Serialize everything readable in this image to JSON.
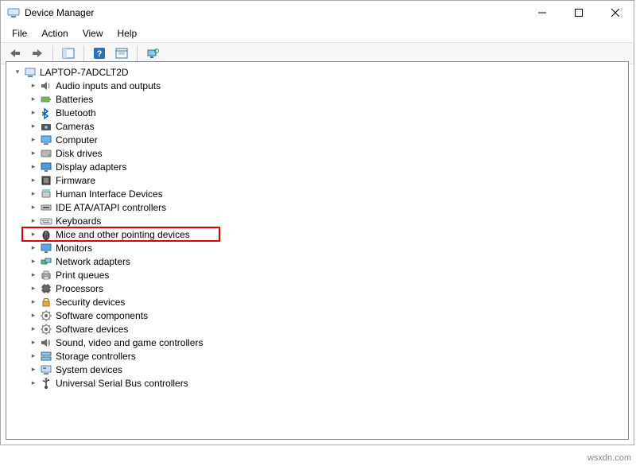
{
  "window": {
    "title": "Device Manager"
  },
  "menu": {
    "file": "File",
    "action": "Action",
    "view": "View",
    "help": "Help"
  },
  "tree": {
    "root": "LAPTOP-7ADCLT2D",
    "items": [
      {
        "label": "Audio inputs and outputs",
        "icon": "audio"
      },
      {
        "label": "Batteries",
        "icon": "battery"
      },
      {
        "label": "Bluetooth",
        "icon": "bluetooth"
      },
      {
        "label": "Cameras",
        "icon": "camera"
      },
      {
        "label": "Computer",
        "icon": "computer"
      },
      {
        "label": "Disk drives",
        "icon": "disk"
      },
      {
        "label": "Display adapters",
        "icon": "display"
      },
      {
        "label": "Firmware",
        "icon": "firmware"
      },
      {
        "label": "Human Interface Devices",
        "icon": "hid"
      },
      {
        "label": "IDE ATA/ATAPI controllers",
        "icon": "ide"
      },
      {
        "label": "Keyboards",
        "icon": "keyboard"
      },
      {
        "label": "Mice and other pointing devices",
        "icon": "mouse",
        "highlighted": true
      },
      {
        "label": "Monitors",
        "icon": "monitor"
      },
      {
        "label": "Network adapters",
        "icon": "network"
      },
      {
        "label": "Print queues",
        "icon": "printer"
      },
      {
        "label": "Processors",
        "icon": "cpu"
      },
      {
        "label": "Security devices",
        "icon": "security"
      },
      {
        "label": "Software components",
        "icon": "software"
      },
      {
        "label": "Software devices",
        "icon": "software"
      },
      {
        "label": "Sound, video and game controllers",
        "icon": "sound"
      },
      {
        "label": "Storage controllers",
        "icon": "storage"
      },
      {
        "label": "System devices",
        "icon": "system"
      },
      {
        "label": "Universal Serial Bus controllers",
        "icon": "usb"
      }
    ]
  },
  "watermark": "wsxdn.com"
}
